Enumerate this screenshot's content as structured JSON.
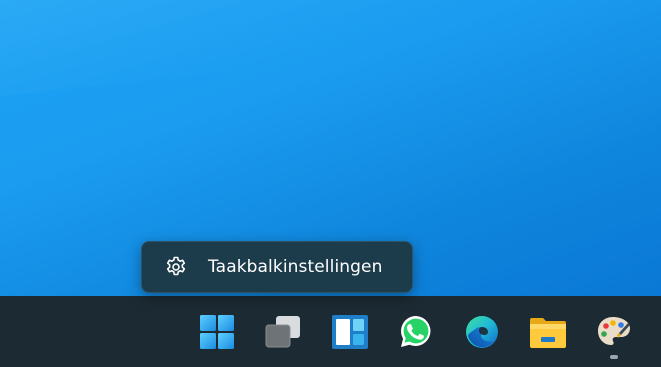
{
  "context_menu": {
    "items": [
      {
        "label": "Taakbalkinstellingen",
        "icon": "gear-icon"
      }
    ]
  },
  "taskbar": {
    "apps": [
      {
        "name": "start",
        "icon": "windows-start-icon"
      },
      {
        "name": "task-view",
        "icon": "task-view-icon"
      },
      {
        "name": "widgets",
        "icon": "widgets-icon"
      },
      {
        "name": "whatsapp",
        "icon": "whatsapp-icon"
      },
      {
        "name": "edge",
        "icon": "edge-icon"
      },
      {
        "name": "file-explorer",
        "icon": "folder-icon"
      },
      {
        "name": "paint",
        "icon": "paint-icon",
        "running": true
      }
    ]
  },
  "colors": {
    "desktop_blue": "#1b9cf0",
    "taskbar_bg": "#1c2a33",
    "menu_bg": "#1d3c4b"
  }
}
